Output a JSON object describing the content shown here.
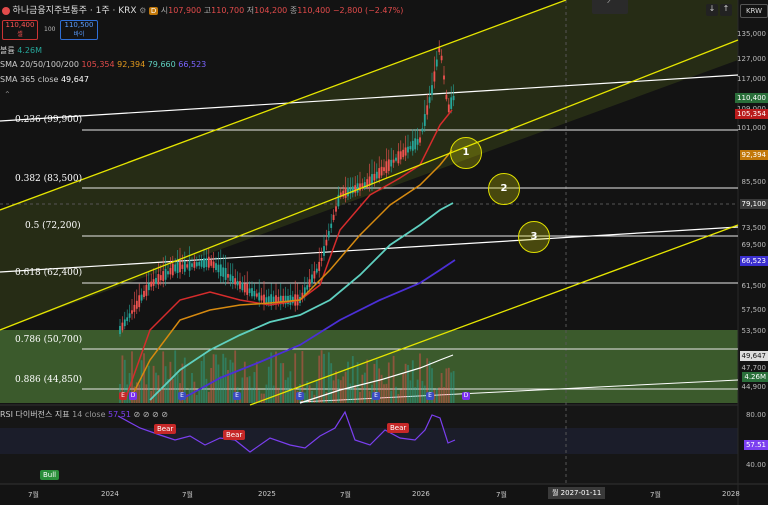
{
  "header": {
    "title": "하나금융지주보통주 · 1주 · KRX",
    "open_label": "시",
    "open": "107,900",
    "high_label": "고",
    "high": "110,700",
    "low_label": "저",
    "low": "104,200",
    "close_label": "종",
    "close": "110,400",
    "change": "−2,800 (−2.47%)",
    "d_badge": "D",
    "sell_price": "110,400",
    "sell_label": "셀",
    "quantity": "100",
    "buy_price": "110,500",
    "buy_label": "바이",
    "currency": "KRW"
  },
  "indicators": {
    "volume_label": "볼륨",
    "volume_value": "4.26M",
    "sma_label": "SMA 20/50/100/200",
    "sma_values": [
      "105,354",
      "92,394",
      "79,660",
      "66,523"
    ],
    "sma365_label": "SMA 365 close",
    "sma365_value": "49,647",
    "rsi_label": "RSI 다이버전스 지표",
    "rsi_params": "14 close",
    "rsi_value": "57.51",
    "rsi_icons": "⊘ ⊘ ⊘ ⊘"
  },
  "fib_levels": [
    {
      "label": "0.236 (99,900)"
    },
    {
      "label": "0.382 (83,500)"
    },
    {
      "label": "0.5 (72,200)"
    },
    {
      "label": "0.618 (62,400)"
    },
    {
      "label": "0.786 (50,700)"
    },
    {
      "label": "0.886 (44,850)"
    }
  ],
  "annotations": {
    "c1": "1",
    "c2": "2",
    "c3": "3"
  },
  "price_axis": {
    "ticks": [
      "135,000",
      "127,000",
      "117,000",
      "109,000",
      "101,000",
      "85,500",
      "79,100",
      "73,500",
      "69,500",
      "61,500",
      "57,500",
      "53,500",
      "47,700",
      "44,900"
    ],
    "markers": [
      {
        "text": "110,400",
        "color": "#2a6f3a"
      },
      {
        "text": "105,354",
        "color": "#b91c1c"
      },
      {
        "text": "92,394",
        "color": "#c2780a"
      },
      {
        "text": "79,100",
        "color": "#3a3a3a"
      },
      {
        "text": "66,523",
        "color": "#3b2fd0"
      },
      {
        "text": "49,647",
        "color": "#dddddd"
      },
      {
        "text": "4.26M",
        "color": "#2a6f3a"
      }
    ]
  },
  "rsi_axis": {
    "top": "80.00",
    "bottom": "40.00",
    "current": "57.51"
  },
  "signals": {
    "bear": "Bear",
    "bull": "Bull"
  },
  "time_axis": {
    "labels": [
      "7월",
      "2024",
      "7월",
      "2025",
      "7월",
      "2026",
      "7월",
      "7월",
      "2028"
    ],
    "crosshair_date": "월 2027-01-11"
  },
  "earnings_badge": "E",
  "dividend_badge": "D",
  "colors": {
    "background": "#131313",
    "up_candle": "#26a69a",
    "down_candle": "#ef5350",
    "sma20": "#d62c2c",
    "sma50": "#d68a10",
    "sma100": "#5fd0c0",
    "sma200": "#4b2fd6",
    "channel": "#e6e600",
    "rsi_line": "#7b3ff0"
  }
}
